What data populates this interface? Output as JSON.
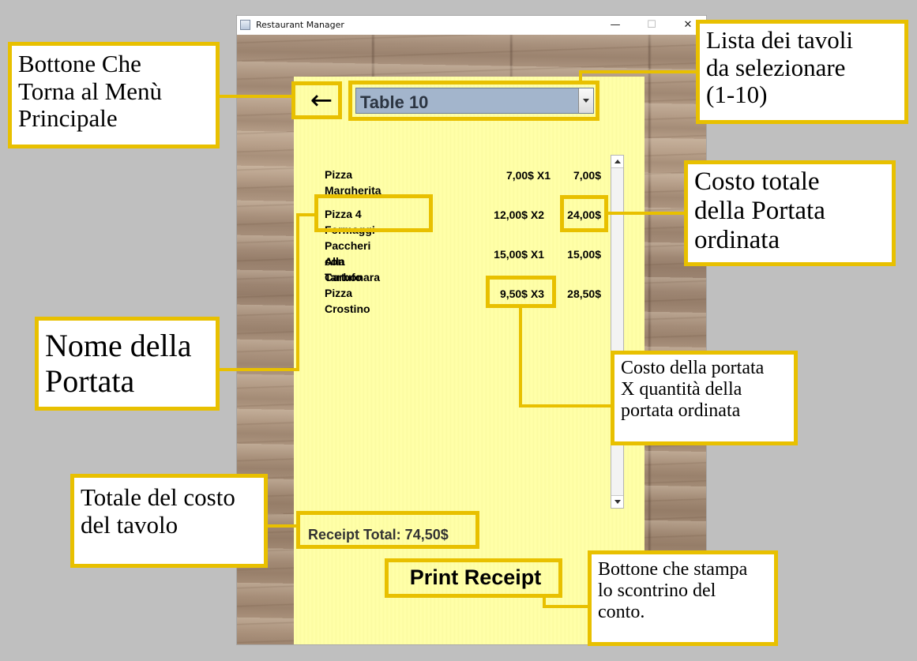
{
  "window": {
    "title": "Restaurant Manager",
    "controls": {
      "minimize": "—",
      "maximize": "☐",
      "close": "✕"
    }
  },
  "receipt": {
    "back_icon": "←",
    "table_selector": {
      "selected": "Table 10"
    },
    "items": [
      {
        "name": "Pizza Margherita",
        "unit": "7,00$ X1",
        "total": "7,00$"
      },
      {
        "name": "Pizza 4 Formaggi",
        "unit": "12,00$ X2",
        "total": "24,00$"
      },
      {
        "name": "Paccheri Alla Carbonara",
        "name_line2": "con Tartufo",
        "unit": "15,00$ X1",
        "total": "15,00$"
      },
      {
        "name": "Pizza Crostino",
        "unit": "9,50$ X3",
        "total": "28,50$"
      }
    ],
    "total_label": "Receipt Total: 74,50$",
    "print_label": "Print Receipt"
  },
  "annotations": {
    "back_button": [
      "Bottone Che",
      "Torna al Menù",
      "Principale"
    ],
    "table_list": [
      "Lista dei tavoli",
      "da selezionare",
      "(1-10)"
    ],
    "dish_total": [
      "Costo totale",
      "della Portata",
      "ordinata"
    ],
    "dish_name": [
      "Nome della",
      "Portata"
    ],
    "unit_cost": [
      "Costo della portata",
      "X quantità della",
      "portata ordinata"
    ],
    "table_total": [
      "Totale del costo",
      "del tavolo"
    ],
    "print_button": [
      "Bottone che stampa",
      "lo scontrino del",
      "conto."
    ]
  },
  "colors": {
    "highlight": "#e8c000",
    "paper": "#ffffa8",
    "selector": "#a3b5cc"
  }
}
